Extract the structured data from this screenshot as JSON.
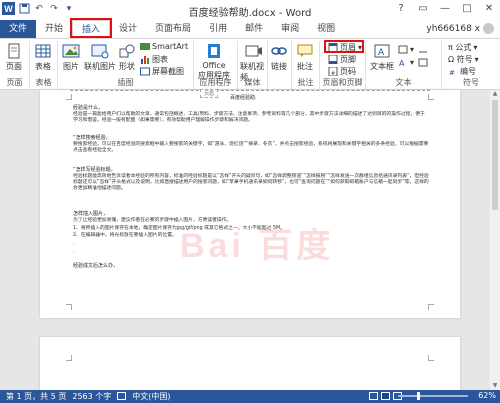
{
  "titlebar": {
    "app_icon": "W",
    "title": "百度经验帮助.docx - Word",
    "qat": [
      "save-icon",
      "undo-icon",
      "redo-icon",
      "customize-icon"
    ],
    "controls": [
      "?",
      "▭",
      "—",
      "□",
      "✕"
    ]
  },
  "tabs": {
    "file": "文件",
    "items": [
      "开始",
      "插入",
      "设计",
      "页面布局",
      "引用",
      "邮件",
      "审阅",
      "视图"
    ],
    "active": "插入",
    "user": "yh666168 x"
  },
  "ribbon": {
    "groups": {
      "pages": "页面",
      "tables": "表格",
      "illustrations": "插图",
      "apps": "应用程序",
      "media": "媒体",
      "links": "",
      "comments": "批注",
      "header_footer": "页眉和页脚",
      "text": "文本",
      "symbols": "符号"
    },
    "buttons": {
      "page": "页面",
      "table": "表格",
      "picture": "图片",
      "online_picture": "联机图片",
      "shapes": "形状",
      "smartart": "SmartArt",
      "chart": "图表",
      "screenshot": "屏幕截图",
      "office_apps": "Office",
      "office_apps2": "应用程序",
      "online_video": "联机视频",
      "links": "链接",
      "comment": "批注",
      "header": "页眉",
      "footer": "页脚",
      "page_number": "页码",
      "textbox": "文本框",
      "equation": "π 公式",
      "symbol": "Ω 符号",
      "number": "编号"
    }
  },
  "document": {
    "header_label": "页眉",
    "doc_title": "百度经验助.",
    "p1_heading": "经验是什么，",
    "p1": "经验是一篇能给用户们以帮助的文章，通常包括概述、工具/原料、步骤方法、注意事项、参考资料等几个部分，其中步骤方法详细的描述了达到目的的操作过程，便于学习和借鉴。经验一般有配图（如果需要），有效帮助用户理解操作步骤和解决问题。",
    "p2_heading": "“怎样搜索经验，",
    "p2": "要搜索经验，可以在百度经验的搜索框中输入要搜索的关键字，如“游泳、烧红烧”“摘录、冬衣”，并点击搜索经验，系统将展现和关键字相关的多条经验，可以根据需要点击查看经验全文。",
    "p3_heading": "“怎样写经验标题，",
    "p3": "经验标题能高效地告诉读者本经验的所有内容，标准的经验标题是以“怎样”开头的疑问句，如“怎样调整频道”“怎样报税”“怎样发送一次群组信息给通讯录列表”，但经验标题还可以“怎样”开头格式以及说明，比如直接描述用户的搜索问题，如“苹果手机通讯录如何转移”，也可“查询问题在”“如何获取邮箱账户与信箱一起同步”等，这样的会更加精准地描述问题。",
    "p4_heading": "怎样插入图片，",
    "p4": "为了让经验更加易懂，建议作者在必要的步骤中插入图片，方便读者操作。",
    "p4_items": [
      "1、将所插入的图片保存在本地，确定图片保存为jpg/gif/png 或其它格式之一，大小不能超过 5M。",
      "2、在编辑器中，将光标放在要插入图片的位置。"
    ],
    "p5_heading": "经验成文后怎么办，",
    "watermark": "Bai 百度"
  },
  "status": {
    "page": "第 1 页，共 5 页",
    "words": "2563 个字",
    "lang_icon": "proofing-icon",
    "lang": "中文(中国)",
    "zoom": "62%",
    "zoom_level": 0.62
  },
  "colors": {
    "accent": "#2b579a",
    "highlight": "#e01010",
    "office": "#d83b01"
  }
}
